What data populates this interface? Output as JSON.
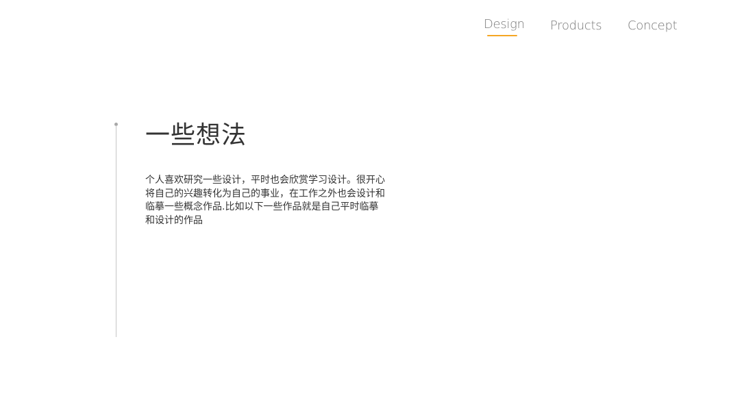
{
  "nav": {
    "items": [
      {
        "label": "Design",
        "active": true
      },
      {
        "label": "Products",
        "active": false
      },
      {
        "label": "Concept",
        "active": false
      }
    ],
    "accent_color": "#f5a623"
  },
  "main": {
    "title": "一些想法",
    "paragraph_lines": [
      "个人喜欢研究一些设计，平时也会欣赏学习设计。很开心",
      "将自己的兴趣转化为自己的事业，在工作之外也会设计和",
      "临摹一些概念作品.比如以下一些作品就是自己平时临摹",
      "和设计的作品"
    ]
  }
}
